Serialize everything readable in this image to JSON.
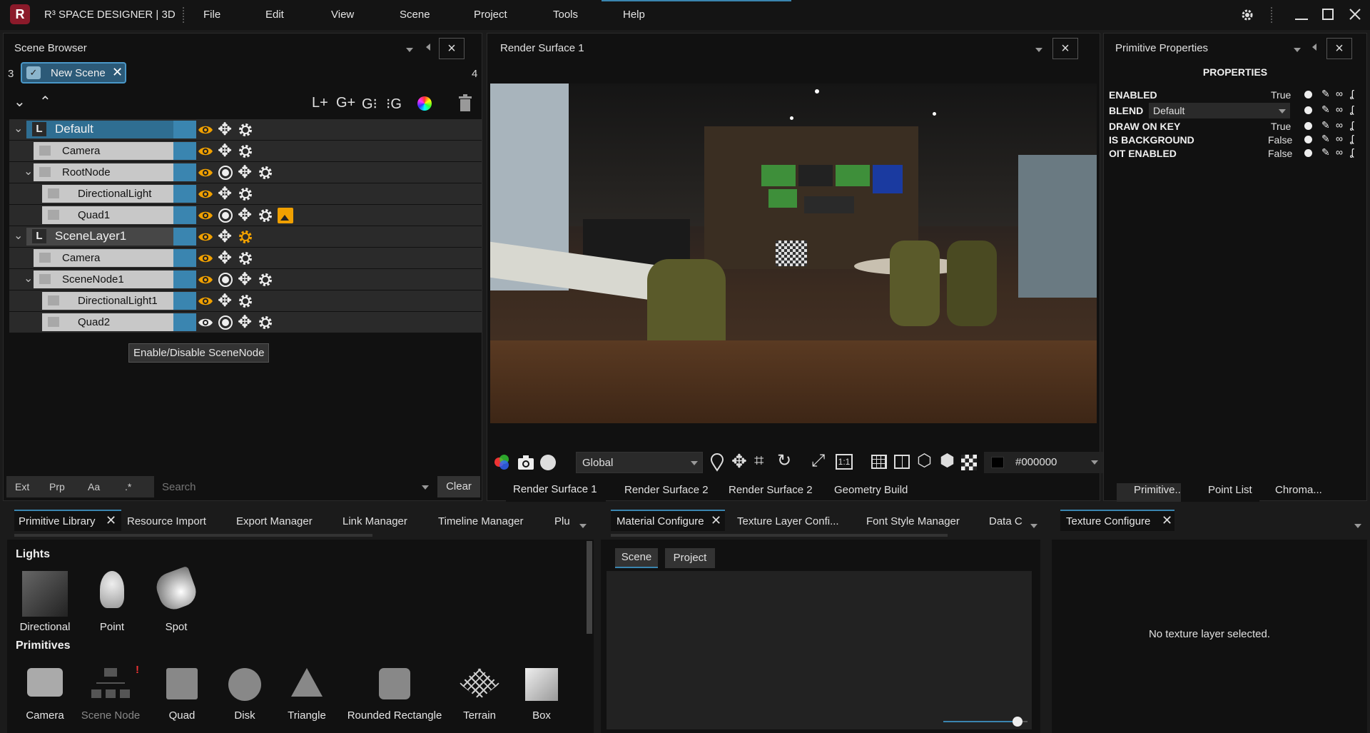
{
  "app": {
    "title": "R³ SPACE DESIGNER | 3D",
    "logo": "R"
  },
  "menu": [
    "File",
    "Edit",
    "View",
    "Scene",
    "Project",
    "Tools",
    "Help"
  ],
  "scene_browser": {
    "title": "Scene Browser",
    "left_count": "3",
    "right_count": "4",
    "scene_tab": "New Scene",
    "toolbar": [
      "L+",
      "G+",
      "G⁝",
      "⁝G"
    ],
    "rows": [
      {
        "name": "Default",
        "type": "layer"
      },
      {
        "name": "Camera",
        "type": "camera"
      },
      {
        "name": "RootNode",
        "type": "node"
      },
      {
        "name": "DirectionalLight",
        "type": "light"
      },
      {
        "name": "Quad1",
        "type": "quad"
      },
      {
        "name": "SceneLayer1",
        "type": "layer"
      },
      {
        "name": "Camera",
        "type": "camera"
      },
      {
        "name": "SceneNode1",
        "type": "node"
      },
      {
        "name": "DirectionalLight1",
        "type": "light"
      },
      {
        "name": "Quad2",
        "type": "quad"
      }
    ],
    "tooltip": "Enable/Disable SceneNode",
    "filters": [
      "Ext",
      "Prp",
      "Aa",
      ".*"
    ],
    "search_placeholder": "Search",
    "clear_label": "Clear"
  },
  "render": {
    "title": "Render Surface 1",
    "space_select": "Global",
    "color_value": "#000000",
    "tabs": [
      "Render Surface 1",
      "Render Surface 2",
      "Render Surface 2",
      "Geometry Build"
    ]
  },
  "properties": {
    "title": "Primitive Properties",
    "header": "PROPERTIES",
    "rows": [
      {
        "key": "ENABLED",
        "value": "True"
      },
      {
        "key": "BLEND",
        "value": "Default"
      },
      {
        "key": "DRAW ON KEY",
        "value": "True"
      },
      {
        "key": "IS BACKGROUND",
        "value": "False"
      },
      {
        "key": "OIT ENABLED",
        "value": "False"
      }
    ],
    "tabs": [
      "Primitive...",
      "Point List",
      "Chroma..."
    ]
  },
  "bottom_left_tabs": [
    "Primitive Library",
    "Resource Import",
    "Export Manager",
    "Link Manager",
    "Timeline Manager",
    "Plu"
  ],
  "library": {
    "lights_title": "Lights",
    "lights": [
      "Directional",
      "Point",
      "Spot"
    ],
    "primitives_title": "Primitives",
    "primitives": [
      "Camera",
      "Scene Node",
      "Quad",
      "Disk",
      "Triangle",
      "Rounded Rectangle",
      "Terrain",
      "Box"
    ]
  },
  "bottom_mid_tabs": [
    "Material Configure",
    "Texture Layer Confi...",
    "Font Style Manager",
    "Data C"
  ],
  "material": {
    "subtabs": [
      "Scene",
      "Project"
    ],
    "slider_value": 0.88
  },
  "texture": {
    "tab": "Texture Configure",
    "empty_message": "No texture layer selected."
  },
  "colors": {
    "accent": "#3a85b0",
    "eye": "#f0a000",
    "bg": "#111111"
  }
}
